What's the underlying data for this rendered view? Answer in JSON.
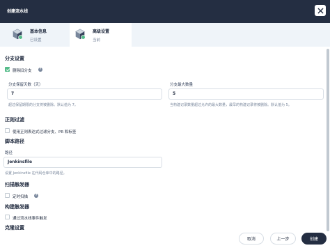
{
  "dialog": {
    "title": "创建流水线"
  },
  "steps": [
    {
      "title": "基本信息",
      "status": "已设置"
    },
    {
      "title": "高级设置",
      "status": "当前"
    }
  ],
  "branch_settings": {
    "title": "分支设置",
    "discard_old_branches": {
      "label": "删除旧分支",
      "checked": true
    },
    "days_to_keep": {
      "label": "分支保留天数（天）",
      "value": "7",
      "hint": "超过保留期限的分支将被删除。默认值为 7。"
    },
    "max_branches": {
      "label": "分支最大数量",
      "value": "5",
      "hint": "当构建记录数量超过允许的最大数量，最早的构建记录将被删除。默认值为 5。"
    }
  },
  "regex_filter": {
    "title": "正则过滤",
    "option": {
      "label": "使用正则表达式过滤分支、PR 和标签",
      "checked": false
    }
  },
  "script_path": {
    "title": "脚本路径",
    "label": "路径",
    "value": "Jenkinsfile",
    "hint": "设置 Jenkinsfile 在代码仓库中的路径。"
  },
  "scan_trigger": {
    "title": "扫描触发器",
    "option": {
      "label": "定时扫描",
      "checked": false
    }
  },
  "build_trigger": {
    "title": "构建触发器",
    "option": {
      "label": "通过流水线事件触发",
      "checked": false
    }
  },
  "next_section": {
    "title": "克隆设置"
  },
  "footer": {
    "cancel": "取消",
    "previous": "上一步",
    "create": "创建"
  },
  "colors": {
    "header_bg": "#242e42",
    "accent_green": "#55bc8a",
    "primary_button": "#242e42"
  }
}
